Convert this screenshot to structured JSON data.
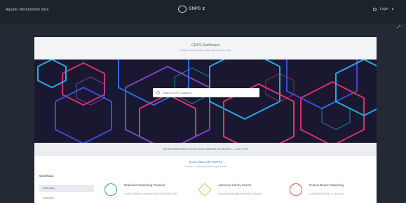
{
  "topbar": {
    "left_text": "Aquatic Metabolome data",
    "brand": "GNPS",
    "version": "2",
    "user_label": "Login",
    "menu_label": "≡"
  },
  "panel": {
    "title": "GNPS Dashboard",
    "subtitle": "Analyze and visualize mass spectrometry data"
  },
  "hero": {
    "search_placeholder": "Search GNPS datasets"
  },
  "linkbar": {
    "text_before": "Use the dashboard to explore public datasets and libraries —",
    "link_text": "learn more"
  },
  "lower": {
    "title": "Quick Start with GNPS2",
    "subtitle": "Choose a workflow below to get started"
  },
  "sidebar": {
    "heading": "Workflows",
    "active_item": "Overview",
    "item": "Datasets"
  },
  "cards": [
    {
      "title": "Molecular Networking Classical",
      "desc": "Create molecular networks from your MS/MS data",
      "color": "#3aa877",
      "icon": "network-icon"
    },
    {
      "title": "Advanced Library Search",
      "desc": "Search spectra against reference libraries",
      "color": "#e3a32c",
      "icon": "warning-icon"
    },
    {
      "title": "Feature Based Networking",
      "desc": "Link features across LC-MS runs",
      "color": "#e05353",
      "icon": "alert-icon"
    }
  ],
  "colors": {
    "topbar": "#1c232b",
    "background": "#232a33",
    "accent": "#4a86c8"
  }
}
